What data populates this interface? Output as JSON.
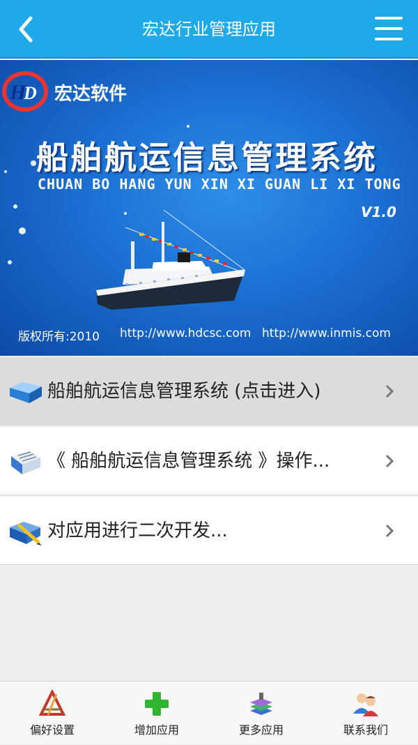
{
  "header": {
    "title": "宏达行业管理应用",
    "back_icon": "chevron-left-icon",
    "menu_icon": "hamburger-menu-icon"
  },
  "banner": {
    "company": "宏达软件",
    "system_title": "船舶航运信息管理系统",
    "pinyin": "CHUAN BO HANG YUN XIN XI GUAN LI XI TONG",
    "version": "V1.0",
    "copyright": "版权所有:2010",
    "url1": "http://www.hdcsc.com",
    "url2": "http://www.inmis.com"
  },
  "menu_items": [
    {
      "label": "船舶航运信息管理系统 (点击进入)",
      "icon": "folder-icon",
      "selected": true
    },
    {
      "label": "《 船舶航运信息管理系统 》操作...",
      "icon": "document-icon",
      "selected": false
    },
    {
      "label": "对应用进行二次开发...",
      "icon": "edit-icon",
      "selected": false
    }
  ],
  "bottom_nav": [
    {
      "label": "偏好设置",
      "icon": "preferences-icon"
    },
    {
      "label": "增加应用",
      "icon": "add-icon"
    },
    {
      "label": "更多应用",
      "icon": "more-apps-icon"
    },
    {
      "label": "联系我们",
      "icon": "contact-icon"
    }
  ],
  "colors": {
    "header_bg": "#1fa9e8",
    "banner_bg": "#1b6fd1",
    "selected_row": "#dcdcdc",
    "add_green": "#2fb52f"
  }
}
